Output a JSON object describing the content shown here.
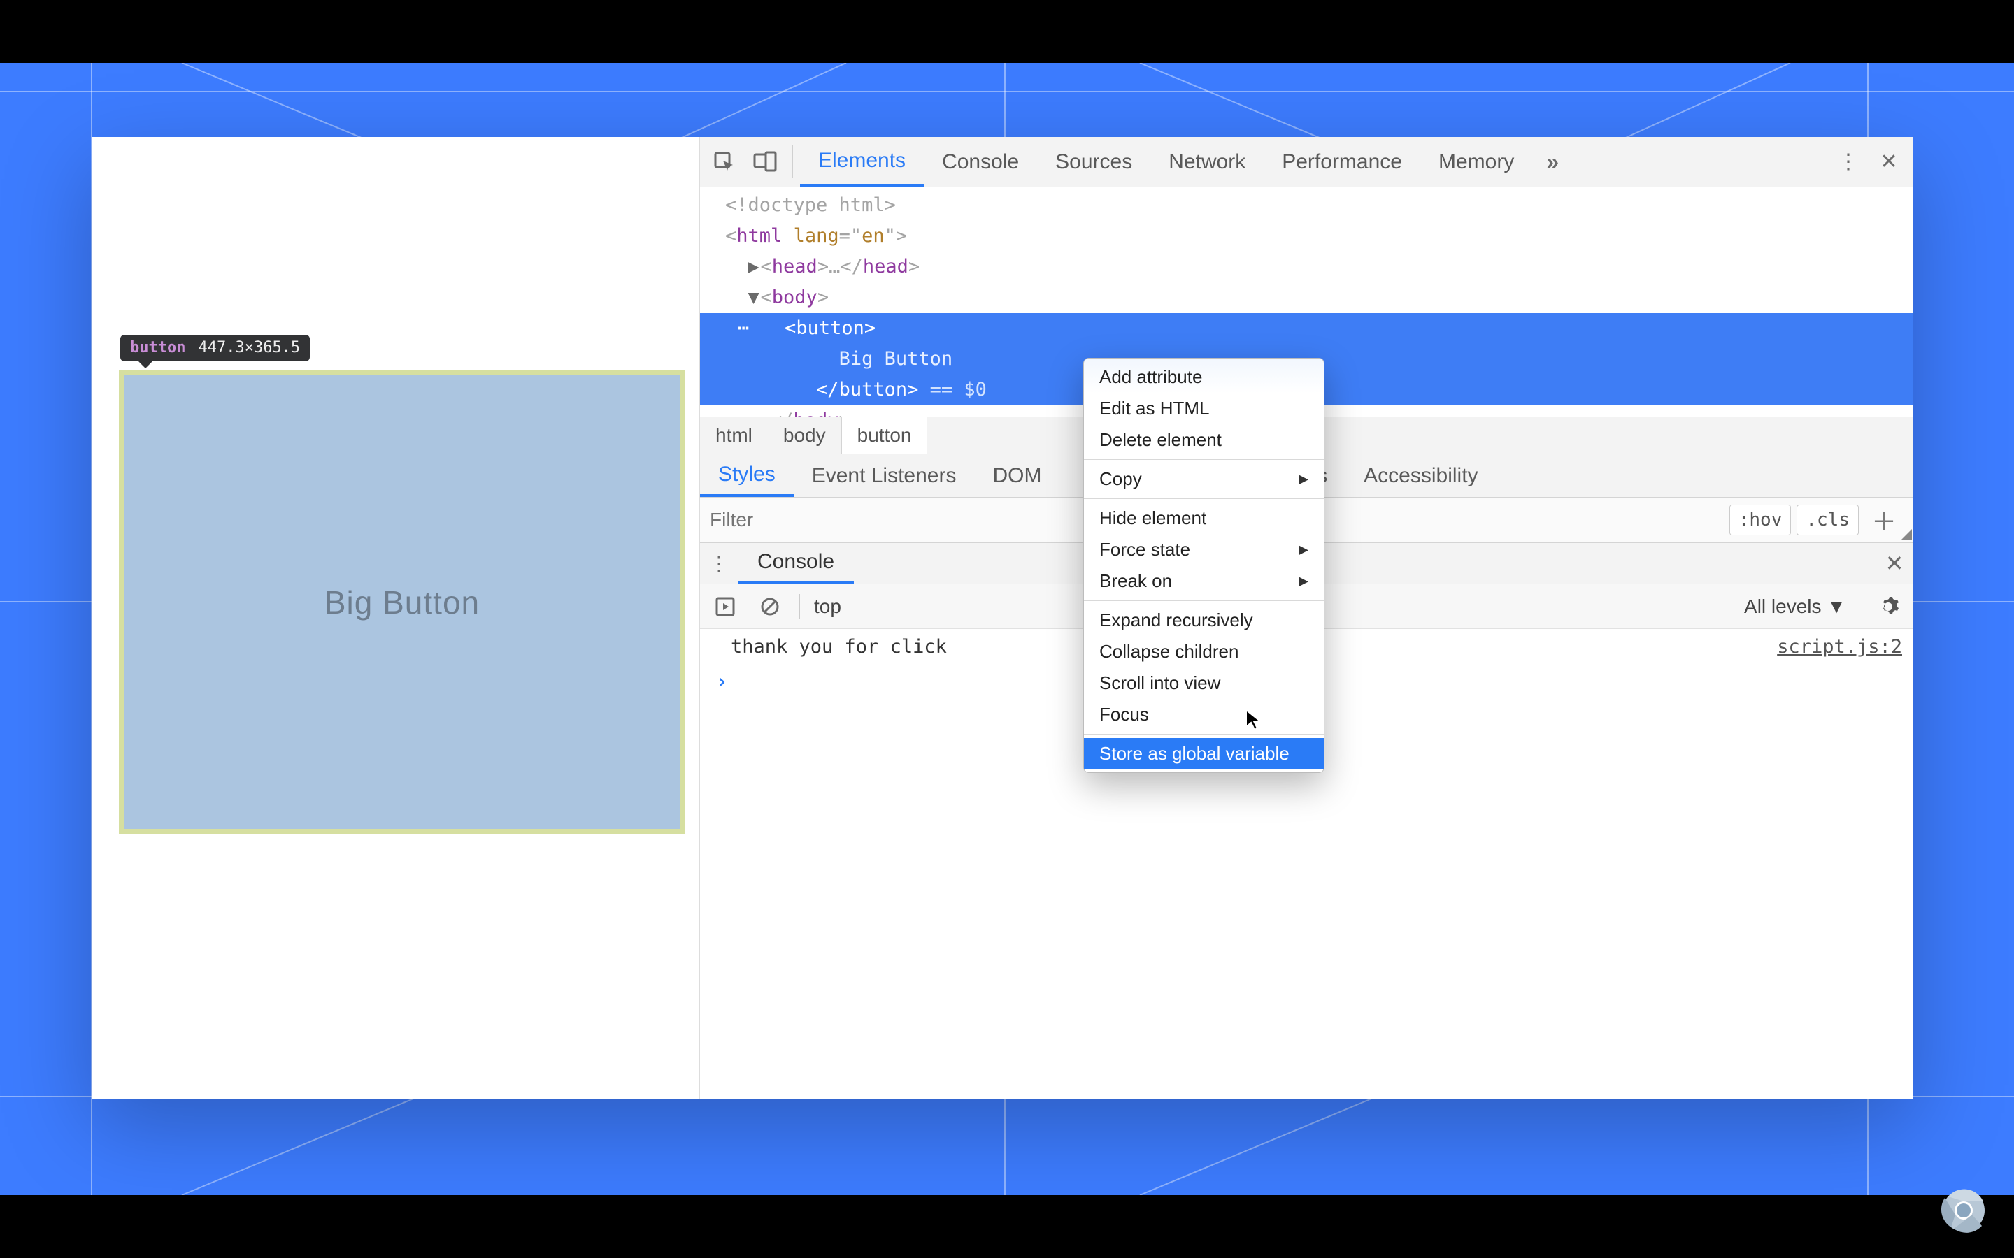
{
  "tooltip": {
    "tag": "button",
    "dims": "447.3×365.5"
  },
  "page": {
    "big_button_label": "Big Button"
  },
  "devtools": {
    "tabs": [
      "Elements",
      "Console",
      "Sources",
      "Network",
      "Performance",
      "Memory"
    ],
    "active_tab": "Elements",
    "dom": {
      "doctype": "<!doctype html>",
      "html_open": "<html lang=\"en\">",
      "head": "<head>…</head>",
      "body_open": "<body>",
      "button_open": "<button>",
      "button_text": "Big Button",
      "button_close": "</button>",
      "dollar0": " == $0",
      "body_close": "</body>"
    },
    "breadcrumbs": [
      "html",
      "body",
      "button"
    ],
    "subtabs": [
      "Styles",
      "Event Listeners",
      "DOM Breakpoints",
      "Properties",
      "Accessibility"
    ],
    "subtab_active": "Styles",
    "filter_placeholder": "Filter",
    "toggles": {
      "hov": ":hov",
      "cls": ".cls"
    },
    "drawer": {
      "tab": "Console",
      "context": "top",
      "levels": "All levels ▼",
      "log_msg": "thank you for click",
      "log_src": "script.js:2"
    }
  },
  "context_menu": {
    "items": [
      {
        "label": "Add attribute"
      },
      {
        "label": "Edit as HTML"
      },
      {
        "label": "Delete element"
      },
      {
        "sep": true
      },
      {
        "label": "Copy",
        "submenu": true
      },
      {
        "sep": true
      },
      {
        "label": "Hide element"
      },
      {
        "label": "Force state",
        "submenu": true
      },
      {
        "label": "Break on",
        "submenu": true
      },
      {
        "sep": true
      },
      {
        "label": "Expand recursively"
      },
      {
        "label": "Collapse children"
      },
      {
        "label": "Scroll into view"
      },
      {
        "label": "Focus"
      },
      {
        "sep": true
      },
      {
        "label": "Store as global variable",
        "highlight": true
      }
    ]
  }
}
